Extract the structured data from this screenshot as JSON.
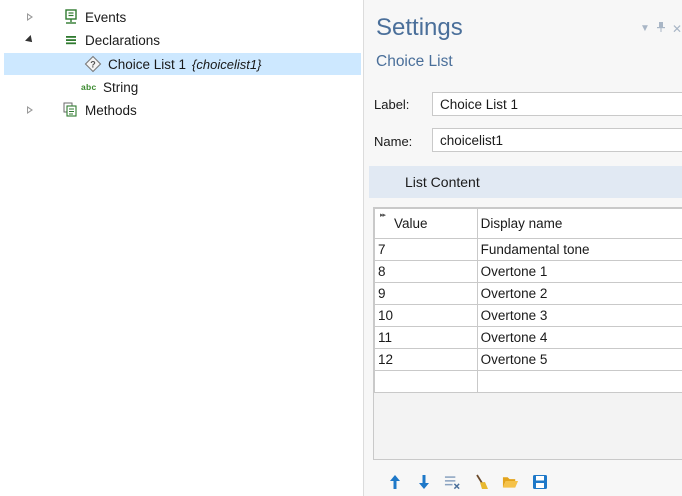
{
  "tree": {
    "items": [
      {
        "label": "Events",
        "icon": "events-icon"
      },
      {
        "label": "Declarations",
        "icon": "declarations-icon"
      },
      {
        "label": "Choice List 1",
        "sub": "{choicelist1}",
        "icon": "choice-list-icon"
      },
      {
        "label": "String",
        "icon_text": "abc"
      },
      {
        "label": "Methods",
        "icon": "methods-icon"
      }
    ]
  },
  "settings": {
    "title": "Settings",
    "subtitle": "Choice List",
    "label_caption": "Label:",
    "label_value": "Choice List 1",
    "name_caption": "Name:",
    "name_value": "choicelist1",
    "section_title": "List Content",
    "table": {
      "headers": [
        "Value",
        "Display name"
      ],
      "rows": [
        [
          "7",
          "Fundamental tone"
        ],
        [
          "8",
          "Overtone 1"
        ],
        [
          "9",
          "Overtone 2"
        ],
        [
          "10",
          "Overtone 3"
        ],
        [
          "11",
          "Overtone 4"
        ],
        [
          "12",
          "Overtone 5"
        ],
        [
          "",
          ""
        ]
      ]
    },
    "toolbar": [
      "move-up-icon",
      "move-down-icon",
      "delete-rows-icon",
      "clear-table-icon",
      "load-from-file-icon",
      "save-to-file-icon"
    ]
  },
  "colors": {
    "accent": "#4a6f9a",
    "selection": "#cde8ff",
    "section_bg": "#e1e9f3",
    "toolbar_blue": "#1e78c8"
  }
}
